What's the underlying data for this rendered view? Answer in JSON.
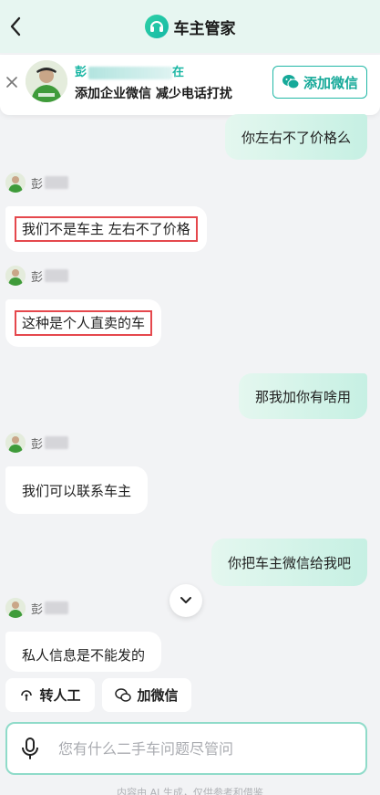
{
  "header": {
    "title": "车主管家",
    "back_icon": "chevron-left-icon",
    "logo_icon": "headset-icon"
  },
  "banner": {
    "name": "彭",
    "name_suffix": "在",
    "subtitle": "添加企业微信 减少电话打扰",
    "button_label": "添加微信",
    "close_icon": "close-icon"
  },
  "messages": [
    {
      "side": "right",
      "text": "你左右不了价格么"
    },
    {
      "side": "left",
      "sender": "彭",
      "text": "我们不是车主 左右不了价格",
      "highlighted": true
    },
    {
      "side": "left",
      "sender": "彭",
      "text": "这种是个人直卖的车",
      "highlighted": true
    },
    {
      "side": "right",
      "text": "那我加你有啥用"
    },
    {
      "side": "left",
      "sender": "彭",
      "text": "我们可以联系车主"
    },
    {
      "side": "right",
      "text": "你把车主微信给我吧"
    },
    {
      "side": "left",
      "sender": "彭",
      "text": "私人信息是不能发的"
    }
  ],
  "quick_actions": {
    "transfer_label": "转人工",
    "wechat_label": "加微信"
  },
  "input": {
    "placeholder": "您有什么二手车问题尽管问"
  },
  "footer": {
    "note": "内容由 AI 生成，仅供参考和借鉴"
  },
  "colors": {
    "accent": "#16a999",
    "highlight_border": "#e5484d",
    "header_bg": "#e7f6f1"
  }
}
